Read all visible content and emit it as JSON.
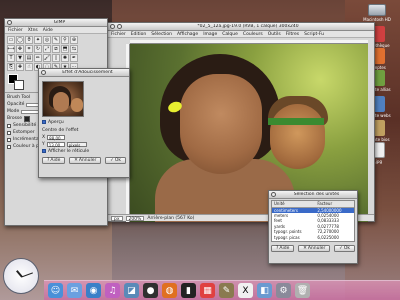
{
  "desktop": {
    "icons": [
      {
        "label": "Macintosh HD"
      },
      {
        "label": "Bibliothèque"
      },
      {
        "label": "Comptes"
      },
      {
        "label": "Compte allias"
      },
      {
        "label": "Compte webs"
      },
      {
        "label": "Compte bios"
      },
      {
        "label": "1.jpg"
      }
    ]
  },
  "toolbox": {
    "title": "GIMP",
    "menu": [
      "Fichier",
      "Xtns",
      "Aide"
    ],
    "tool_icons": [
      "rect-select-icon",
      "ellipse-select-icon",
      "lasso-icon",
      "wand-icon",
      "fuzzy-icon",
      "path-icon",
      "color-picker-icon",
      "zoom-icon",
      "measure-icon",
      "move-icon",
      "crop-icon",
      "rotate-icon",
      "scale-icon",
      "shear-icon",
      "perspective-icon",
      "flip-icon",
      "text-icon",
      "bucket-icon",
      "gradient-icon",
      "pencil-icon",
      "brush-icon",
      "eraser-icon",
      "airbrush-icon",
      "ink-icon",
      "clone-icon",
      "heal-icon",
      "smudge-icon",
      "dodge-icon",
      "blur-icon",
      "path2-icon",
      "star-icon",
      "extra-icon"
    ],
    "tool_options_title": "Brush Tool",
    "opacity_label": "Opacité",
    "mode_label": "Mode",
    "brush_label": "Brosse",
    "sensitive_label": "Sensibilité à la pression",
    "fade_label": "Estomper",
    "incremental_label": "Incrémental",
    "color_gradient_label": "Couleur à partir du dégradé"
  },
  "image_window": {
    "title": "*02_5_12a.jpg-19.0 (RVB, 1 calque) 300x240",
    "menu": [
      "Fichier",
      "Edition",
      "Sélection",
      "Affichage",
      "Image",
      "Calque",
      "Couleurs",
      "Outils",
      "Filtres",
      "Script-Fu",
      "Fenêtres",
      "Aide"
    ],
    "unit": "px",
    "zoom": "200%",
    "status": "Arrière-plan (567 Ko)"
  },
  "effect_dialog": {
    "title": "Effet d'Adoucissement",
    "preview_label": "Aperçu",
    "center_label": "Centre de l'effet",
    "x_label": "X",
    "x_value": "88,00",
    "y_label": "Y",
    "y_value": "13,00",
    "unit_value": "pixels",
    "crosshair_label": "Afficher le réticule",
    "help_label": "Aide",
    "cancel_label": "Annuler",
    "ok_label": "Ok"
  },
  "units_dialog": {
    "title": "Sélection des unités",
    "headers": [
      "Unité",
      "Facteur"
    ],
    "rows": [
      {
        "unit": "centimeters",
        "factor": "2,54000000"
      },
      {
        "unit": "meters",
        "factor": "0,0254000"
      },
      {
        "unit": "feet",
        "factor": "0,0833333"
      },
      {
        "unit": "yards",
        "factor": "0,0277778"
      },
      {
        "unit": "typogr. points",
        "factor": "72,270000"
      },
      {
        "unit": "typogr. picas",
        "factor": "6,0225000"
      }
    ],
    "help_label": "Aide",
    "cancel_label": "Annuler",
    "ok_label": "Ok"
  },
  "dock": {
    "items": [
      "finder-icon",
      "mail-icon",
      "safari-icon",
      "itunes-icon",
      "iphoto-icon",
      "dvd-icon",
      "firefox-icon",
      "terminal-icon",
      "ical-icon",
      "gimp-icon",
      "x11-icon",
      "preview-icon",
      "sysprefs-icon",
      "trash-icon"
    ]
  }
}
